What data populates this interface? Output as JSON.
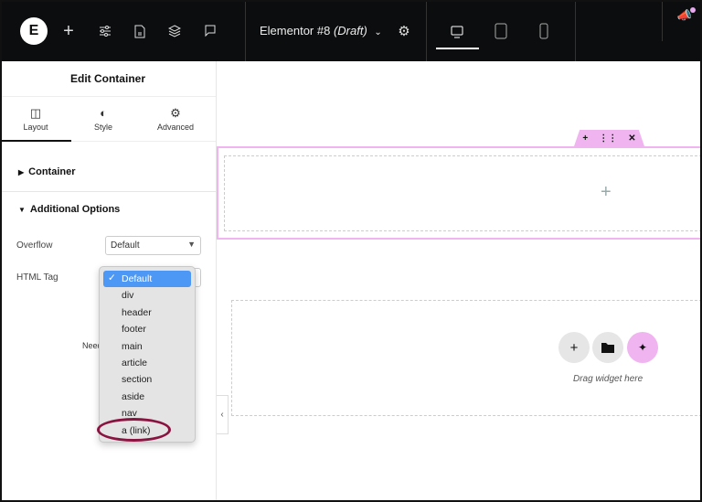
{
  "topbar": {
    "logo": "E",
    "title": "Elementor #8",
    "title_status": "(Draft)",
    "icons": [
      "plus-icon",
      "sliders-icon",
      "page-icon",
      "layers-icon",
      "comment-icon",
      "settings-icon",
      "desktop-icon",
      "tablet-icon",
      "mobile-icon",
      "megaphone-icon"
    ]
  },
  "panel": {
    "title": "Edit Container",
    "tabs": [
      {
        "label": "Layout",
        "icon": "layout-icon"
      },
      {
        "label": "Style",
        "icon": "half-circle-icon"
      },
      {
        "label": "Advanced",
        "icon": "gear-icon"
      }
    ],
    "sections": {
      "container": "Container",
      "additional": "Additional Options"
    },
    "overflow": {
      "label": "Overflow",
      "value": "Default"
    },
    "html_tag": {
      "label": "HTML Tag",
      "value": "Default",
      "options": [
        "Default",
        "div",
        "header",
        "footer",
        "main",
        "article",
        "section",
        "aside",
        "nav",
        "a (link)"
      ]
    },
    "need_text": "Need"
  },
  "canvas": {
    "drag_text": "Drag widget here",
    "accent": "#f0b5f0",
    "highlight_ring": "#8a1440"
  }
}
